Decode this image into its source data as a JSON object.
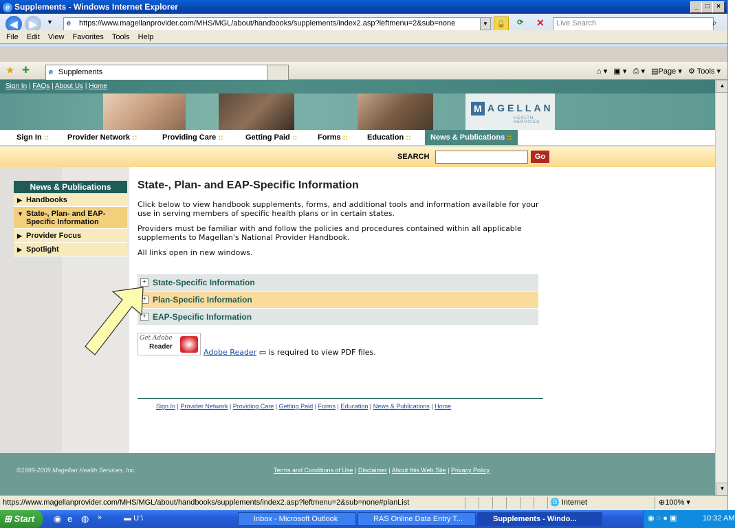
{
  "window": {
    "title": "Supplements - Windows Internet Explorer",
    "url": "https://www.magellanprovider.com/MHS/MGL/about/handbooks/supplements/index2.asp?leftmenu=2&sub=none",
    "search_placeholder": "Live Search",
    "menu": [
      "File",
      "Edit",
      "View",
      "Favorites",
      "Tools",
      "Help"
    ],
    "tab_title": "Supplements",
    "command_bar": {
      "page": "Page",
      "tools": "Tools"
    }
  },
  "site": {
    "top_links": [
      "Sign In",
      "FAQs",
      "About Us",
      "Home"
    ],
    "logo": {
      "word": "AGELLAN",
      "letter": "M",
      "sub": "HEALTH SERVICES"
    },
    "nav": [
      "Sign In",
      "Provider Network",
      "Providing Care",
      "Getting Paid",
      "Forms",
      "Education",
      "News & Publications"
    ],
    "search_label": "SEARCH",
    "search_go": "Go",
    "sidenav": {
      "heading": "News & Publications",
      "items": [
        "Handbooks",
        "State-, Plan- and EAP-Specific Information",
        "Provider Focus",
        "Spotlight"
      ]
    },
    "content": {
      "title": "State-, Plan- and EAP-Specific Information",
      "para1": "Click below to view handbook supplements, forms, and additional tools and information available for your use in serving members of specific health plans or in certain states.",
      "para2": "Providers must be familiar with and follow the policies and procedures contained within all applicable supplements to Magellan's National Provider Handbook.",
      "para3": "All links open in new windows.",
      "accordion": [
        "State-Specific Information",
        "Plan-Specific Information",
        "EAP-Specific Information"
      ],
      "adobe_badge_get": "Get Adobe",
      "adobe_badge_reader": "Reader",
      "adobe_link": "Adobe Reader",
      "adobe_rest": " is required to view PDF files."
    },
    "footer_nav": [
      "Sign In",
      "Provider Network",
      "Providing Care",
      "Getting Paid",
      "Forms",
      "Education",
      "News & Publications",
      "Home"
    ],
    "copyright": "©1999-2009 Magellan Health Services, Inc.",
    "footer_links": [
      "Terms and Conditions of Use",
      "Disclaimer",
      "About this Web Site",
      "Privacy Policy"
    ]
  },
  "status": {
    "url": "https://www.magellanprovider.com/MHS/MGL/about/handbooks/supplements/index2.asp?leftmenu=2&sub=none#planList",
    "zone": "Internet",
    "zoom": "100%"
  },
  "taskbar": {
    "start": "Start",
    "quick": "U:\\",
    "tasks": [
      "Inbox - Microsoft Outlook",
      "RAS Online Data Entry T...",
      "Supplements - Windo..."
    ],
    "clock": "10:32 AM"
  }
}
